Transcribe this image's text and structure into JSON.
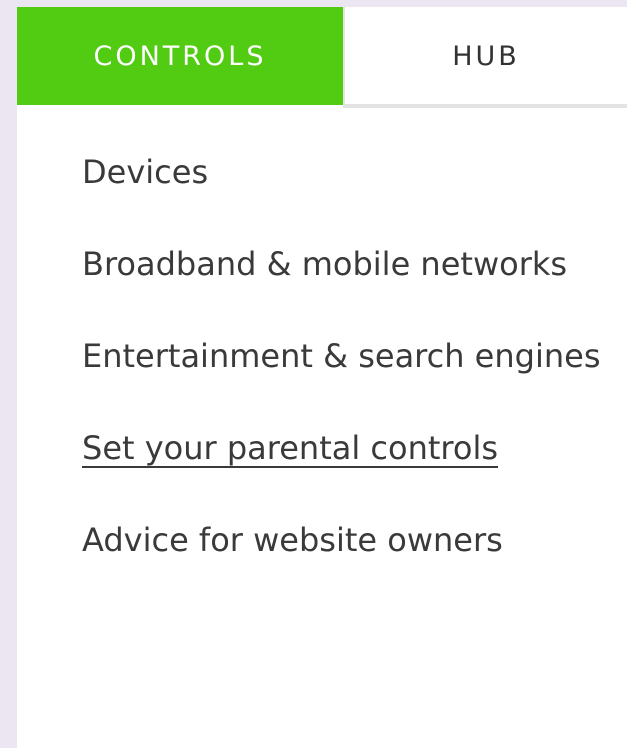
{
  "tabs": [
    {
      "label": "CONTROLS",
      "active": true
    },
    {
      "label": "HUB",
      "active": false
    }
  ],
  "menu": {
    "items": [
      {
        "label": "Devices"
      },
      {
        "label": "Broadband & mobile networks"
      },
      {
        "label": "Entertainment & search engines"
      },
      {
        "label": "Set your parental controls",
        "current": true
      },
      {
        "label": "Advice for website owners"
      }
    ]
  },
  "colors": {
    "accent": "#52cc13",
    "background": "#ebe6f2",
    "text": "#3a3a3a"
  }
}
